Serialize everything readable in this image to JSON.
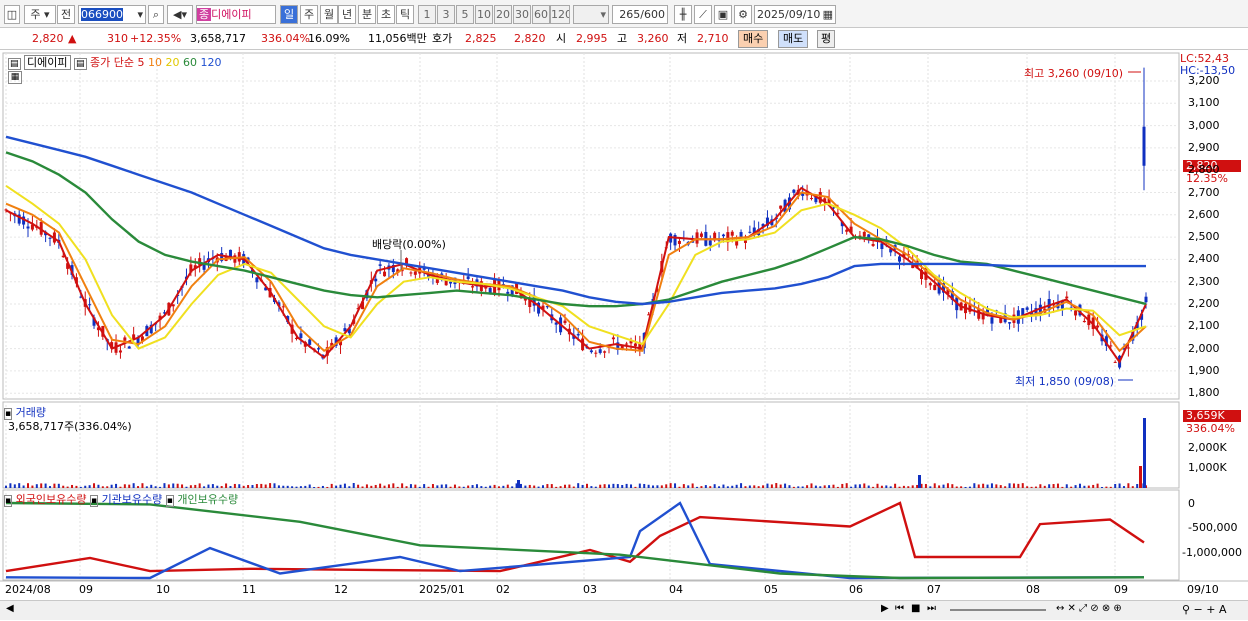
{
  "toolbar": {
    "market": "주",
    "prev": "전",
    "code": "066900",
    "name_badge": "종",
    "name": "디에이피",
    "periods": [
      "일",
      "주",
      "월",
      "년",
      "분",
      "초",
      "틱"
    ],
    "nums": [
      "1",
      "3",
      "5",
      "10",
      "20",
      "30",
      "60",
      "120"
    ],
    "count": "265",
    "count_max": "/600",
    "date": "2025/09/10"
  },
  "info": {
    "price": "2,820",
    "change": "310",
    "change_pct": "+12.35%",
    "volume": "3,658,717",
    "vol_ratio": "336.04%",
    "turnover": "16.09%",
    "amount": "11,056백만",
    "bid_label": "호가",
    "ask": "2,825",
    "bid": "2,820",
    "open_label": "시",
    "open": "2,995",
    "high_label": "고",
    "high": "3,260",
    "low_label": "저",
    "low": "2,710",
    "buy": "매수",
    "sell": "매도",
    "eval": "평"
  },
  "price_panel": {
    "title": "디에이피",
    "ma_label": "종가 단순",
    "ma_periods": [
      "5",
      "10",
      "20",
      "60",
      "120"
    ],
    "ma_colors": [
      "#d01010",
      "#f08010",
      "#f0e020",
      "#2a8a3a",
      "#2050d0"
    ],
    "lc": "LC:52,43",
    "hc": "HC:-13,50",
    "high_note": "최고 3,260 (09/10)",
    "low_note": "최저 1,850 (09/08)",
    "dividend_note": "배당락(0.00%)",
    "last_price_tag": "2,820",
    "last_pct_tag": "12.35%",
    "y_ticks": [
      "3,200",
      "3,100",
      "3,000",
      "2,900",
      "2,800",
      "2,700",
      "2,600",
      "2,500",
      "2,400",
      "2,300",
      "2,200",
      "2,100",
      "2,000",
      "1,900",
      "1,800"
    ]
  },
  "volume_panel": {
    "title": "거래량",
    "value": "3,658,717주(336.04%)",
    "tag_value": "3,659K",
    "tag_pct": "336.04%",
    "y_ticks": [
      "2,000K",
      "1,000K"
    ]
  },
  "holdings_panel": {
    "labels": [
      "외국인보유수량",
      "기관보유수량",
      "개인보유수량"
    ],
    "colors": [
      "#d01010",
      "#2050d0",
      "#2a8a3a"
    ],
    "y_ticks": [
      "0",
      "-500,000",
      "-1,000,000"
    ]
  },
  "x_axis": {
    "labels": [
      "2024/08",
      "09",
      "10",
      "11",
      "12",
      "2025/01",
      "02",
      "03",
      "04",
      "05",
      "06",
      "07",
      "08",
      "09"
    ],
    "end_label": "09/10"
  },
  "chart_data": {
    "type": "candlestick",
    "ohlc_highlights": {
      "high": 3260,
      "high_date": "09/10",
      "low": 1850,
      "low_date": "09/08",
      "last": 2820
    },
    "ma": [
      {
        "name": "5",
        "values": [
          2620,
          2560,
          2480,
          2200,
          2000,
          2050,
          2150,
          2350,
          2420,
          2400,
          2250,
          2050,
          1960,
          2100,
          2350,
          2380,
          2330,
          2300,
          2280,
          2280,
          2200,
          2100,
          2000,
          2020,
          2000,
          2500,
          2490,
          2490,
          2500,
          2580,
          2720,
          2650,
          2500,
          2480,
          2400,
          2300,
          2190,
          2150,
          2130,
          2180,
          2220,
          2110,
          1940,
          2200
        ]
      },
      {
        "name": "10",
        "values": [
          2650,
          2600,
          2520,
          2280,
          2040,
          2020,
          2100,
          2280,
          2400,
          2410,
          2300,
          2100,
          1990,
          2060,
          2280,
          2360,
          2340,
          2310,
          2290,
          2280,
          2230,
          2150,
          2030,
          2000,
          1990,
          2420,
          2490,
          2490,
          2500,
          2550,
          2700,
          2680,
          2560,
          2490,
          2420,
          2320,
          2220,
          2160,
          2130,
          2160,
          2210,
          2150,
          1990,
          2100
        ]
      },
      {
        "name": "20",
        "values": [
          2730,
          2650,
          2560,
          2400,
          2150,
          2000,
          2050,
          2200,
          2330,
          2380,
          2340,
          2220,
          2100,
          2050,
          2200,
          2300,
          2320,
          2300,
          2290,
          2270,
          2230,
          2190,
          2100,
          2060,
          2020,
          2200,
          2420,
          2480,
          2490,
          2520,
          2620,
          2650,
          2600,
          2540,
          2450,
          2330,
          2250,
          2180,
          2140,
          2150,
          2180,
          2170,
          2060,
          2100
        ]
      },
      {
        "name": "60",
        "values": [
          2880,
          2840,
          2780,
          2700,
          2580,
          2480,
          2420,
          2390,
          2370,
          2350,
          2320,
          2290,
          2260,
          2240,
          2230,
          2240,
          2250,
          2260,
          2250,
          2240,
          2220,
          2200,
          2190,
          2190,
          2200,
          2220,
          2260,
          2300,
          2330,
          2360,
          2400,
          2450,
          2500,
          2490,
          2460,
          2420,
          2390,
          2380,
          2350,
          2320,
          2290,
          2260,
          2230,
          2200
        ]
      },
      {
        "name": "120",
        "values": [
          2950,
          2920,
          2890,
          2860,
          2820,
          2780,
          2740,
          2700,
          2650,
          2600,
          2550,
          2500,
          2450,
          2420,
          2400,
          2380,
          2360,
          2340,
          2320,
          2300,
          2280,
          2260,
          2230,
          2210,
          2200,
          2210,
          2230,
          2250,
          2260,
          2270,
          2290,
          2320,
          2370,
          2380,
          2380,
          2380,
          2380,
          2375,
          2370,
          2370,
          2370,
          2370,
          2370,
          2370
        ]
      }
    ],
    "volume": {
      "last": 3658717,
      "unit": "주"
    },
    "holdings": {
      "series": [
        "외국인보유수량",
        "기관보유수량",
        "개인보유수량"
      ],
      "ylim": [
        -1250000,
        100000
      ]
    }
  }
}
